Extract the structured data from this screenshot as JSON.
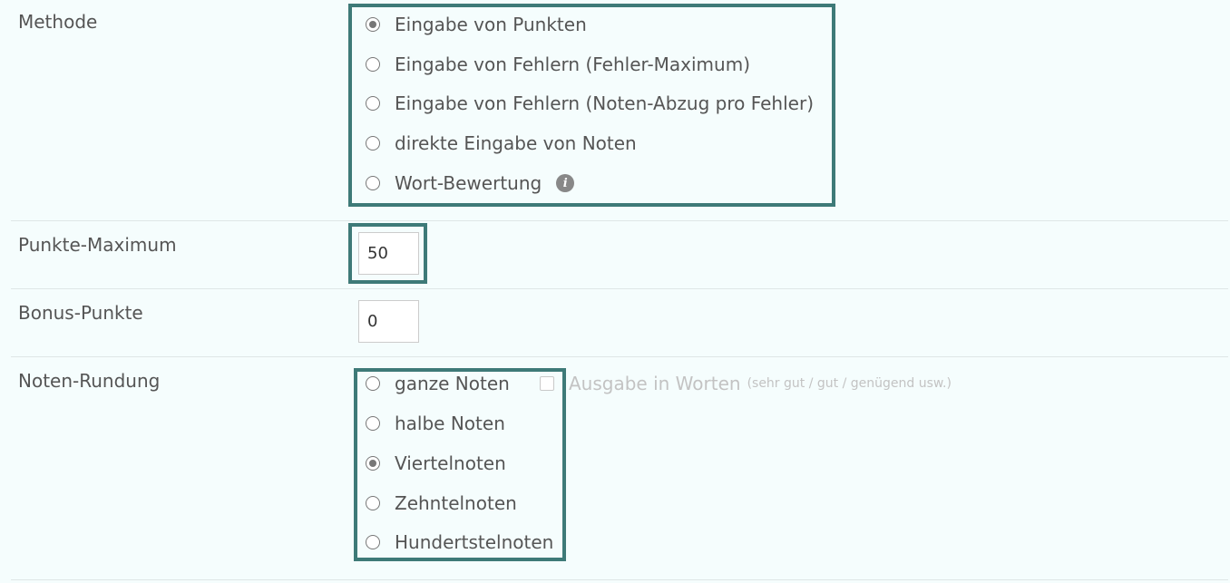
{
  "methode": {
    "label": "Methode",
    "options": [
      {
        "label": "Eingabe von Punkten",
        "checked": true
      },
      {
        "label": "Eingabe von Fehlern (Fehler-Maximum)",
        "checked": false
      },
      {
        "label": "Eingabe von Fehlern (Noten-Abzug pro Fehler)",
        "checked": false
      },
      {
        "label": "direkte Eingabe von Noten",
        "checked": false
      },
      {
        "label": "Wort-Bewertung",
        "checked": false,
        "info_icon": "info-icon",
        "info_glyph": "i"
      }
    ]
  },
  "punkte_maximum": {
    "label": "Punkte-Maximum",
    "value": "50"
  },
  "bonus_punkte": {
    "label": "Bonus-Punkte",
    "value": "0"
  },
  "noten_rundung": {
    "label": "Noten-Rundung",
    "options": [
      {
        "label": "ganze Noten",
        "checked": false
      },
      {
        "label": "halbe Noten",
        "checked": false
      },
      {
        "label": "Viertelnoten",
        "checked": true
      },
      {
        "label": "Zehntelnoten",
        "checked": false
      },
      {
        "label": "Hundertstelnoten",
        "checked": false
      }
    ],
    "words_output": {
      "label": "Ausgabe in Worten",
      "hint": "(sehr gut / gut / genügend usw.)",
      "checked": false,
      "disabled": true
    }
  },
  "colors": {
    "highlight_border": "#3e7a78",
    "background": "#f5fdfd"
  }
}
